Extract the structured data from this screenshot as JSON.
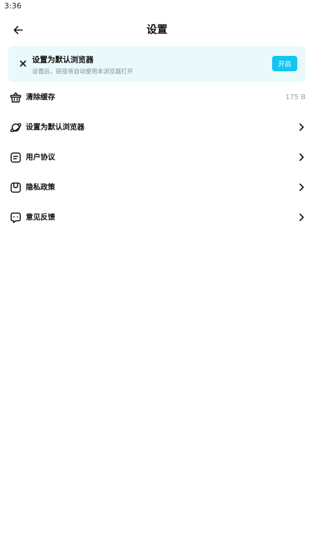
{
  "status_bar": {
    "time": "3:36"
  },
  "header": {
    "title": "设置",
    "back_icon": "arrow-left-icon"
  },
  "banner": {
    "title": "设置为默认浏览器",
    "subtitle": "设置后，链接将自动使用本浏览器打开",
    "button_label": "开启",
    "close_icon": "close-icon",
    "background_color": "#eaf9fb",
    "button_color": "#12c6f0"
  },
  "menu": {
    "items": [
      {
        "label": "清除缓存",
        "value": "175 B",
        "icon": "basket-icon"
      },
      {
        "label": "设置为默认浏览器",
        "icon": "planet-icon"
      },
      {
        "label": "用户协议",
        "icon": "document-icon"
      },
      {
        "label": "隐私政策",
        "icon": "shield-icon"
      },
      {
        "label": "意见反馈",
        "icon": "chat-icon"
      }
    ]
  }
}
